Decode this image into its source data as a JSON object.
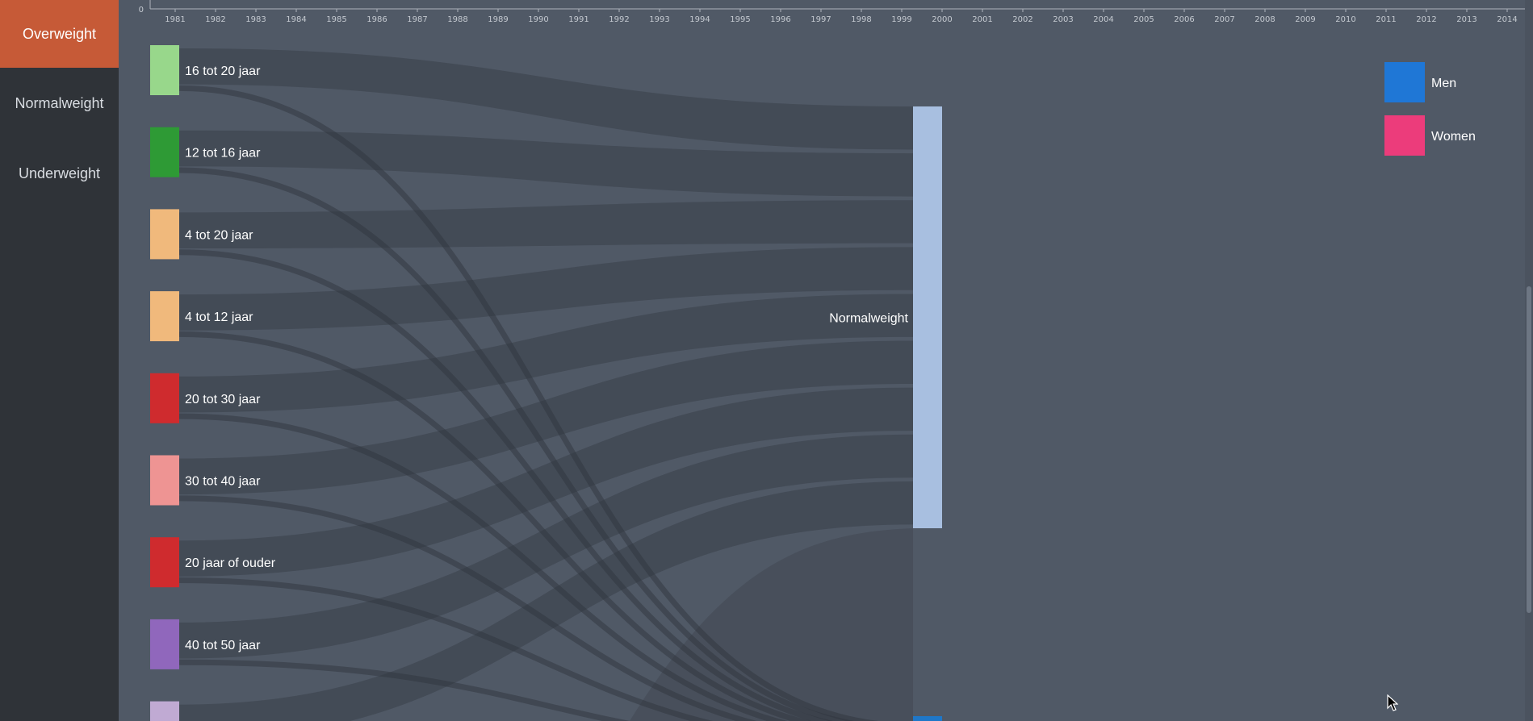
{
  "nav": {
    "items": [
      {
        "id": "overweight",
        "label": "Overweight",
        "active": true
      },
      {
        "id": "normalweight",
        "label": "Normalweight",
        "active": false
      },
      {
        "id": "underweight",
        "label": "Underweight",
        "active": false
      }
    ]
  },
  "chart_data": {
    "type": "sankey",
    "axis": {
      "zero_label": "0",
      "years": [
        "1981",
        "1982",
        "1983",
        "1984",
        "1985",
        "1986",
        "1987",
        "1988",
        "1989",
        "1990",
        "1991",
        "1992",
        "1993",
        "1994",
        "1995",
        "1996",
        "1997",
        "1998",
        "1999",
        "2000",
        "2001",
        "2002",
        "2003",
        "2004",
        "2005",
        "2006",
        "2007",
        "2008",
        "2009",
        "2010",
        "2011",
        "2012",
        "2013",
        "2014"
      ]
    },
    "sources": [
      {
        "label": "16 tot 20 jaar",
        "color": "#98d78b"
      },
      {
        "label": "12 tot 16 jaar",
        "color": "#2e9a35"
      },
      {
        "label": "4 tot 20 jaar",
        "color": "#f0b97c"
      },
      {
        "label": "4 tot 12 jaar",
        "color": "#f0b97c"
      },
      {
        "label": "20 tot 30 jaar",
        "color": "#cf2b2e"
      },
      {
        "label": "30 tot 40 jaar",
        "color": "#ee9493"
      },
      {
        "label": "20 jaar of ouder",
        "color": "#cf2b2e"
      },
      {
        "label": "40 tot 50 jaar",
        "color": "#9067bc"
      },
      {
        "label": "",
        "color": "#c0aad3"
      }
    ],
    "targets": [
      {
        "label": "Normalweight",
        "color": "#a8bfe0"
      },
      {
        "label": "",
        "color": "#1f77c8"
      }
    ],
    "legend": [
      {
        "label": "Men",
        "color": "#1f77d6"
      },
      {
        "label": "Women",
        "color": "#ec3c7b"
      }
    ]
  }
}
